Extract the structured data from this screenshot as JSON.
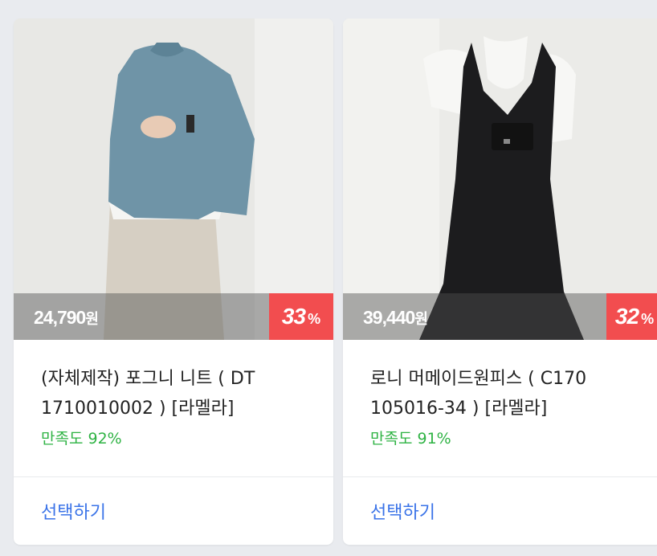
{
  "products": [
    {
      "price": "24,790",
      "currency": "원",
      "discount": "33",
      "discount_unit": "%",
      "title": "(자체제작) 포그니 니트 ( DT 1710010002 ) [라멜라]",
      "satisfaction": "만족도 92%",
      "select_label": "선택하기"
    },
    {
      "price": "39,440",
      "currency": "원",
      "discount": "32",
      "discount_unit": "%",
      "title": "로니 머메이드원피스 ( C170 105016-34 ) [라멜라]",
      "satisfaction": "만족도 91%",
      "select_label": "선택하기"
    }
  ],
  "colors": {
    "discount_badge": "#f24d4f",
    "satisfaction": "#2fb344",
    "select_link": "#3a73e8"
  }
}
